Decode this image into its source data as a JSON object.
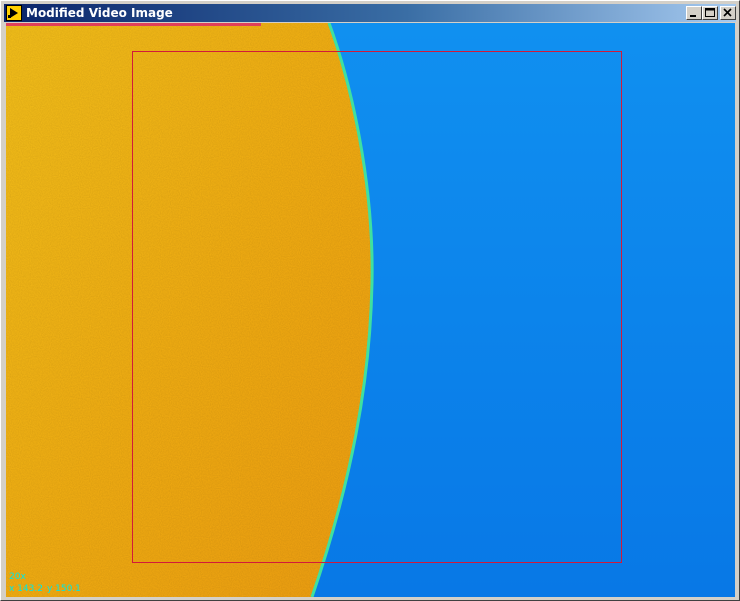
{
  "window": {
    "title": "Modified Video Image"
  },
  "titlebar_buttons": {
    "minimize_icon": "minimize-icon",
    "maximize_icon": "maximize-icon",
    "close_icon": "close-icon"
  },
  "image": {
    "colors": {
      "background_region": "#0a84ec",
      "sample_region": "#f5b412",
      "edge": "#3fe0a0",
      "roi_outline": "#d21a3a",
      "overlay_text": "#00e8e8"
    }
  },
  "overlay": {
    "zoom": "20x",
    "x_label": "x 143.2",
    "y_label": "y 150.1"
  }
}
